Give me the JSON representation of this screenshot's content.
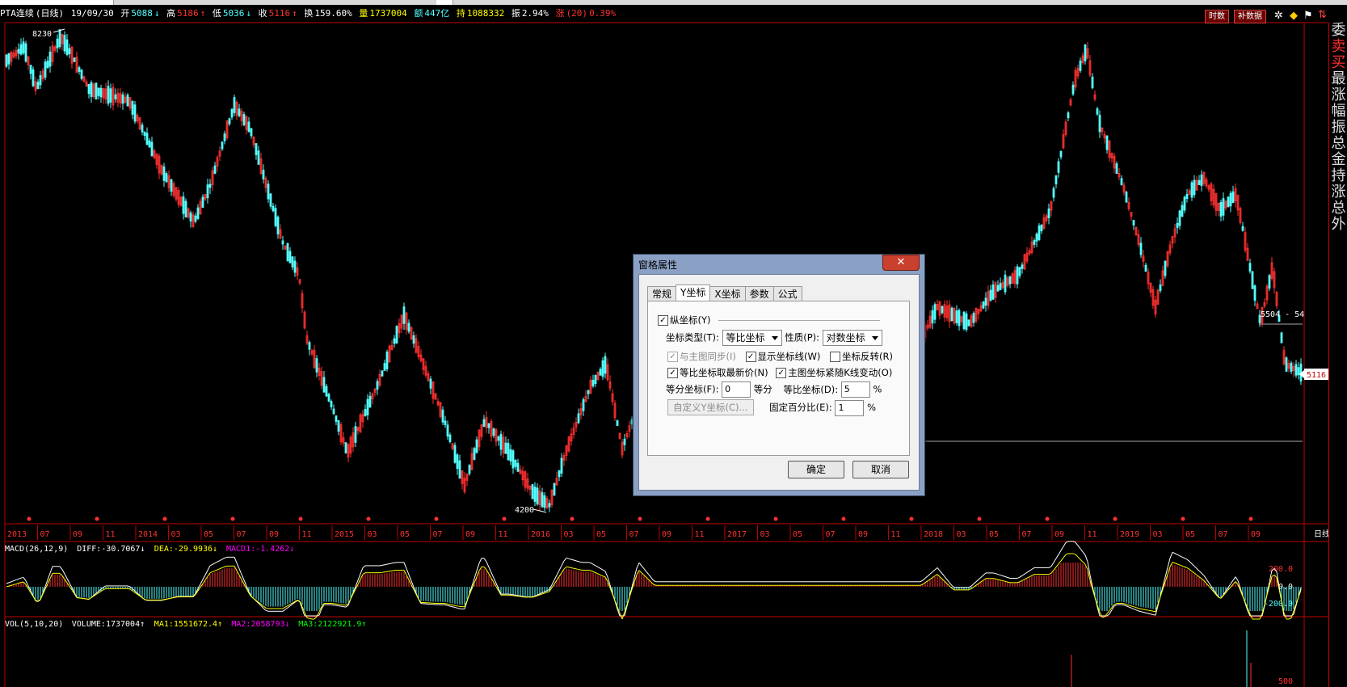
{
  "info_bar": {
    "symbol": "PTA连续",
    "period": "(日线)",
    "date": "19/09/30",
    "open_label": "开",
    "open": "5088",
    "high_label": "高",
    "high": "5186",
    "low_label": "低",
    "low": "5036",
    "close_label": "收",
    "close": "5116",
    "turnover_label": "换",
    "turnover": "159.60%",
    "volume_label": "量",
    "volume": "1737004",
    "amount_label": "额",
    "amount": "447亿",
    "holding_label": "持",
    "holding": "1088332",
    "amplitude_label": "振",
    "amplitude": "2.94%",
    "change_label": "涨",
    "change_period": "(20)",
    "change": "0.39%"
  },
  "top_buttons": {
    "time_share": "时数",
    "supplement": "补数据"
  },
  "price_labels": {
    "high_mark": "8230",
    "low_mark": "4200",
    "current_price": "5116",
    "range_label": "5504 - 54"
  },
  "x_axis": {
    "labels": [
      "2013",
      "07",
      "09",
      "11",
      "2014",
      "03",
      "05",
      "07",
      "09",
      "11",
      "2015",
      "03",
      "05",
      "07",
      "09",
      "11",
      "2016",
      "03",
      "05",
      "07",
      "09",
      "11",
      "2017",
      "03",
      "05",
      "07",
      "09",
      "11",
      "2018",
      "03",
      "05",
      "07",
      "09",
      "11",
      "2019",
      "03",
      "05",
      "07",
      "09"
    ],
    "period_label": "日线"
  },
  "macd": {
    "title": "MACD(26,12,9)",
    "diff": "DIFF:-30.7067",
    "dea": "DEA:-29.9936",
    "macd": "MACD1:-1.4262",
    "scale": [
      "200.0",
      "0.0",
      "-200.0"
    ]
  },
  "vol": {
    "title": "VOL(5,10,20)",
    "volume": "VOLUME:1737004",
    "ma1": "MA1:1551672.4",
    "ma2": "MA2:2058793",
    "ma3": "MA3:2122921.9",
    "scale": "500"
  },
  "right_panel": [
    "委",
    "卖",
    "买",
    "最",
    "涨",
    "幅",
    "振",
    "总",
    "金",
    "持",
    "涨",
    "总",
    "外"
  ],
  "dialog": {
    "title": "窗格属性",
    "close": "✕",
    "tabs": [
      "常规",
      "Y坐标",
      "X坐标",
      "参数",
      "公式"
    ],
    "active_tab": "Y坐标",
    "y_axis_checkbox": "纵坐标(Y)",
    "axis_type_label": "坐标类型(T):",
    "axis_type_value": "等比坐标",
    "nature_label": "性质(P):",
    "nature_value": "对数坐标",
    "sync_main": "与主图同步(I)",
    "show_axis_lines": "显示坐标线(W)",
    "axis_invert": "坐标反转(R)",
    "ratio_latest": "等比坐标取最新价(N)",
    "main_follow_shift": "主图坐标紧随K线变动(O)",
    "equal_div_label": "等分坐标(F):",
    "equal_div_value": "0",
    "equal_div_unit": "等分",
    "ratio_label": "等比坐标(D):",
    "ratio_value": "5",
    "percent1": "%",
    "custom_y": "自定义Y坐标(C)...",
    "fixed_pct_label": "固定百分比(E):",
    "fixed_pct_value": "1",
    "percent2": "%",
    "ok": "确定",
    "cancel": "取消"
  },
  "colors": {
    "up": "#ff3030",
    "down": "#54ffff",
    "frame": "#c00000",
    "diff": "#ffffff",
    "dea": "#ffff00",
    "macd": "#ff00ff",
    "ma3": "#00ff00"
  }
}
